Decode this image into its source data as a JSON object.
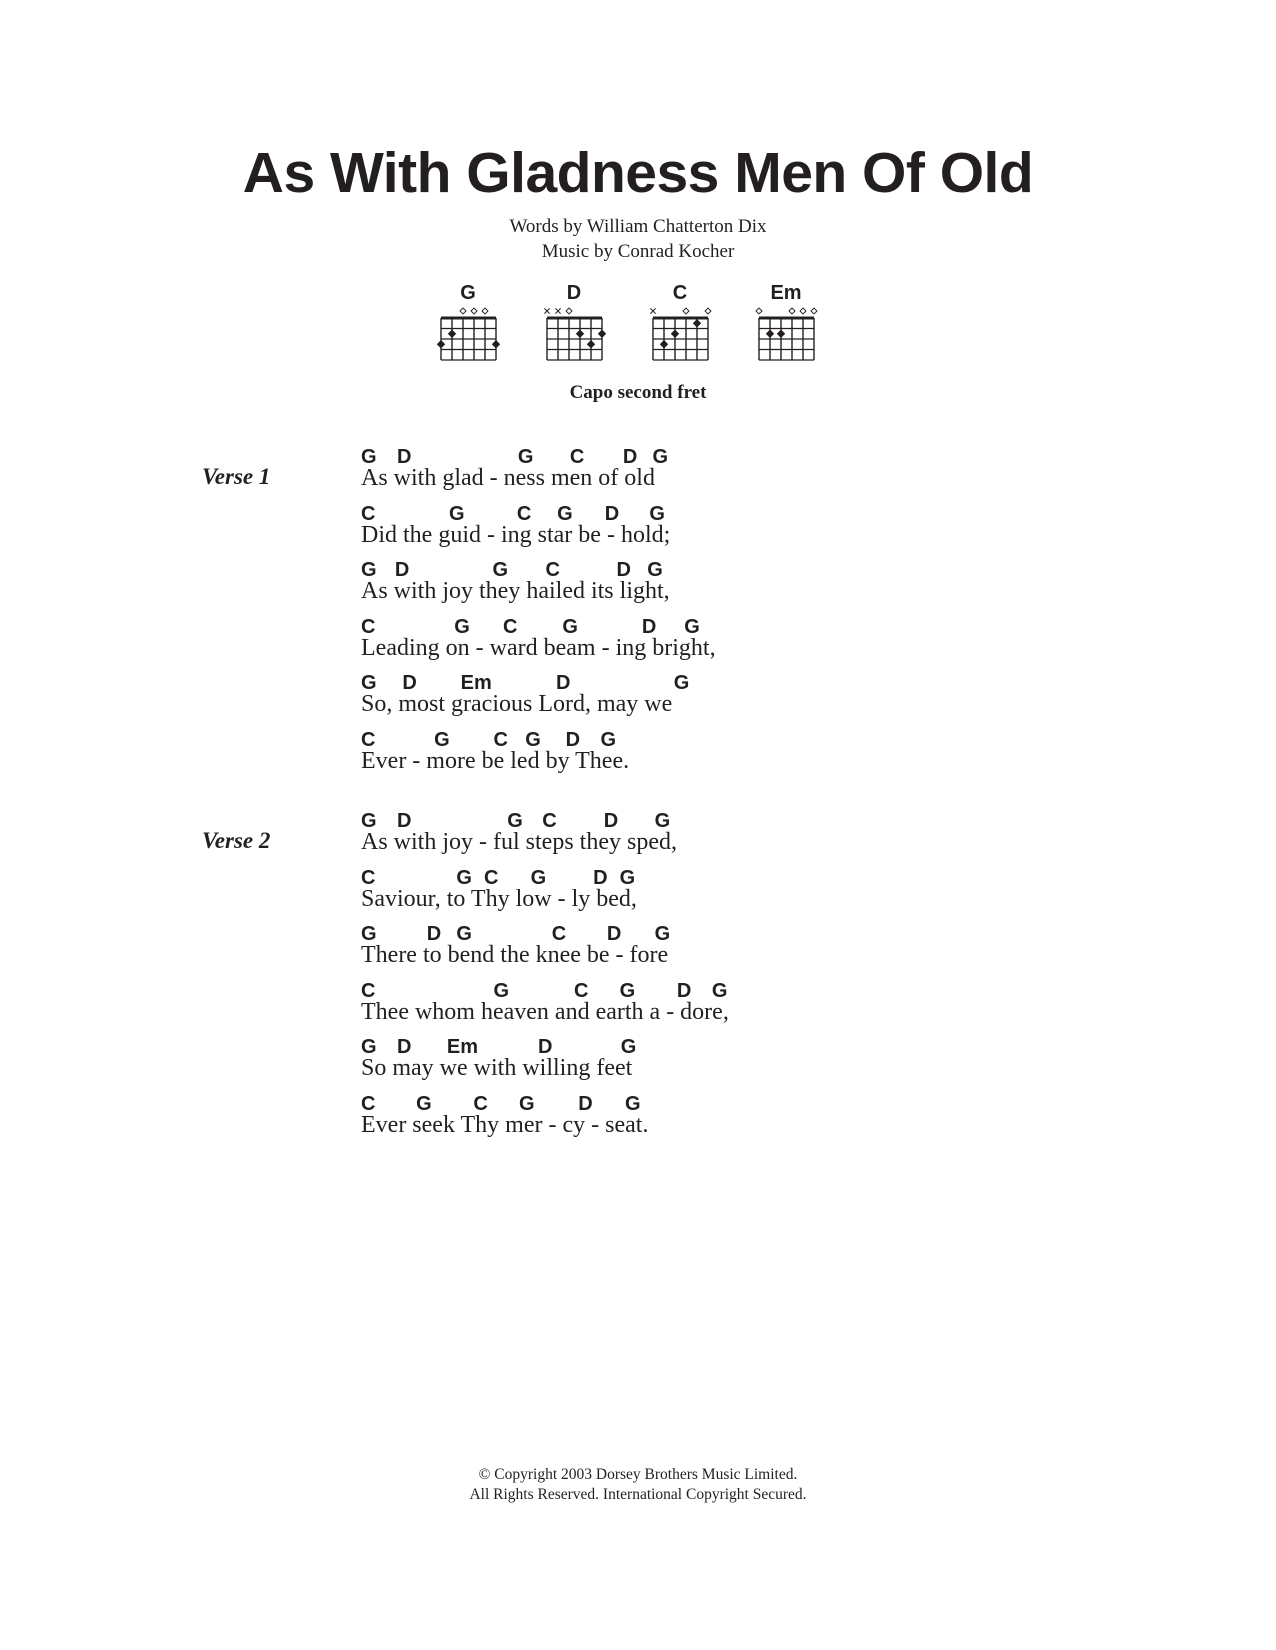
{
  "title": "As With Gladness Men Of Old",
  "credits": {
    "words": "Words by William Chatterton Dix",
    "music": "Music by Conrad Kocher"
  },
  "chord_diagrams": [
    {
      "name": "G",
      "strings": [
        "fret",
        "fret",
        "open",
        "open",
        "open",
        "fret"
      ],
      "dots": [
        [
          6,
          3
        ],
        [
          5,
          2
        ],
        [
          1,
          3
        ]
      ]
    },
    {
      "name": "D",
      "strings": [
        "mute",
        "mute",
        "open",
        "fret",
        "fret",
        "fret"
      ],
      "dots": [
        [
          3,
          2
        ],
        [
          2,
          3
        ],
        [
          1,
          2
        ]
      ]
    },
    {
      "name": "C",
      "strings": [
        "mute",
        "fret",
        "fret",
        "open",
        "fret",
        "open"
      ],
      "dots": [
        [
          5,
          3
        ],
        [
          4,
          2
        ],
        [
          2,
          1
        ]
      ]
    },
    {
      "name": "Em",
      "strings": [
        "open",
        "fret",
        "fret",
        "open",
        "open",
        "open"
      ],
      "dots": [
        [
          5,
          2
        ],
        [
          4,
          2
        ]
      ]
    }
  ],
  "capo": "Capo second fret",
  "verses": [
    {
      "label": "Verse 1",
      "lines": [
        {
          "lyric": "As with glad - ness men of old",
          "chords": [
            [
              "G",
              0
            ],
            [
              "D",
              34
            ],
            [
              "G",
              148
            ],
            [
              "C",
              197
            ],
            [
              "D",
              247
            ],
            [
              "G",
              275
            ]
          ]
        },
        {
          "lyric": "Did the guid - ing star be - hold;",
          "chords": [
            [
              "C",
              0
            ],
            [
              "G",
              83
            ],
            [
              "C",
              147
            ],
            [
              "G",
              185
            ],
            [
              "D",
              230
            ],
            [
              "G",
              272
            ]
          ]
        },
        {
          "lyric": "As with joy they hailed its light,",
          "chords": [
            [
              "G",
              0
            ],
            [
              "D",
              32
            ],
            [
              "G",
              124
            ],
            [
              "C",
              174
            ],
            [
              "D",
              241
            ],
            [
              "G",
              270
            ]
          ]
        },
        {
          "lyric": "Leading on - ward beam - ing bright,",
          "chords": [
            [
              "C",
              0
            ],
            [
              "G",
              88
            ],
            [
              "C",
              134
            ],
            [
              "G",
              190
            ],
            [
              "D",
              265
            ],
            [
              "G",
              305
            ]
          ]
        },
        {
          "lyric": "So, most gracious Lord, may we",
          "chords": [
            [
              "G",
              0
            ],
            [
              "D",
              39
            ],
            [
              "Em",
              94
            ],
            [
              "D",
              184
            ],
            [
              "G",
              295
            ]
          ]
        },
        {
          "lyric": "Ever - more be led by Thee.",
          "chords": [
            [
              "C",
              0
            ],
            [
              "G",
              69
            ],
            [
              "C",
              125
            ],
            [
              "G",
              155
            ],
            [
              "D",
              193
            ],
            [
              "G",
              226
            ]
          ]
        }
      ]
    },
    {
      "label": "Verse 2",
      "lines": [
        {
          "lyric": "As with joy - ful steps they sped,",
          "chords": [
            [
              "G",
              0
            ],
            [
              "D",
              34
            ],
            [
              "G",
              138
            ],
            [
              "C",
              171
            ],
            [
              "D",
              229
            ],
            [
              "G",
              277
            ]
          ]
        },
        {
          "lyric": "Saviour, to Thy low - ly bed,",
          "chords": [
            [
              "C",
              0
            ],
            [
              "G",
              90
            ],
            [
              "C",
              116
            ],
            [
              "G",
              160
            ],
            [
              "D",
              219
            ],
            [
              "G",
              244
            ]
          ]
        },
        {
          "lyric": "There to bend the knee be - fore",
          "chords": [
            [
              "G",
              0
            ],
            [
              "D",
              62
            ],
            [
              "G",
              90
            ],
            [
              "C",
              180
            ],
            [
              "D",
              232
            ],
            [
              "G",
              277
            ]
          ]
        },
        {
          "lyric": "Thee whom heaven and earth a - dore,",
          "chords": [
            [
              "C",
              0
            ],
            [
              "G",
              125
            ],
            [
              "C",
              201
            ],
            [
              "G",
              244
            ],
            [
              "D",
              298
            ],
            [
              "G",
              331
            ]
          ]
        },
        {
          "lyric": "So may we with willing feet",
          "chords": [
            [
              "G",
              0
            ],
            [
              "D",
              34
            ],
            [
              "Em",
              81
            ],
            [
              "D",
              167
            ],
            [
              "G",
              245
            ]
          ]
        },
        {
          "lyric": "Ever seek Thy mer - cy - seat.",
          "chords": [
            [
              "C",
              0
            ],
            [
              "G",
              52
            ],
            [
              "C",
              106
            ],
            [
              "G",
              149
            ],
            [
              "D",
              205
            ],
            [
              "G",
              249
            ]
          ]
        }
      ]
    }
  ],
  "copyright": {
    "line1": "© Copyright 2003 Dorsey Brothers Music Limited.",
    "line2": "All Rights Reserved. International Copyright Secured."
  }
}
